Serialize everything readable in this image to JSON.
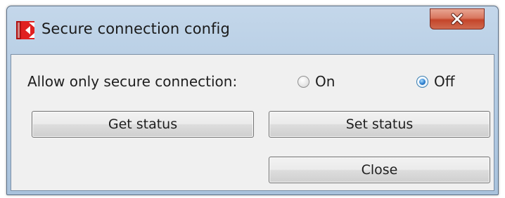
{
  "window": {
    "title": "Secure connection config",
    "app_icon": "k-logo-icon",
    "close_icon": "close-icon"
  },
  "form": {
    "label": "Allow only secure connection:",
    "radios": [
      {
        "label": "On",
        "checked": false
      },
      {
        "label": "Off",
        "checked": true
      }
    ]
  },
  "buttons": {
    "get_status": "Get status",
    "set_status": "Set status",
    "close": "Close"
  },
  "colors": {
    "title_bar": "#b3cbe3",
    "close_button": "#c4452a",
    "client_bg": "#f0f0f0",
    "radio_selected": "#2c7fd0",
    "app_icon_red": "#e02020"
  }
}
